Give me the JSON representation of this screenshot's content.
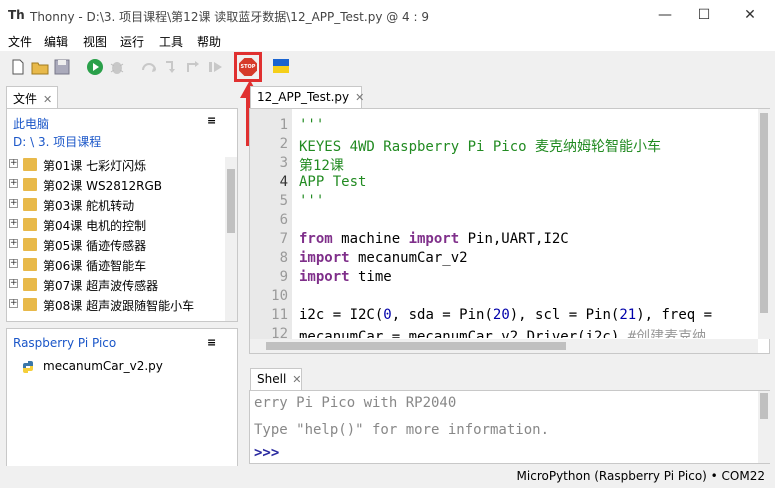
{
  "window": {
    "title": "Thonny  -  D:\\3. 项目课程\\第12课 读取蓝牙数据\\12_APP_Test.py  @  4 : 9",
    "app_icon": "Th",
    "minimize": "—",
    "maximize": "☐",
    "close": "✕"
  },
  "menu": [
    "文件",
    "编辑",
    "视图",
    "运行",
    "工具",
    "帮助"
  ],
  "toolbar": {
    "icons": [
      "new-file-icon",
      "open-file-icon",
      "save-icon",
      "run-icon",
      "debug-icon",
      "step-over-icon",
      "step-into-icon",
      "step-out-icon",
      "resume-icon",
      "stop-icon",
      "flag-icon"
    ],
    "stop_label": "STOP",
    "highlight_color": "#e03030"
  },
  "files_tab": {
    "label": "文件",
    "close": "✕"
  },
  "file_browser": {
    "section_title": "此电脑",
    "path": "D: \\ 3. 项目课程",
    "menu_glyph": "≡",
    "items": [
      "第01课 七彩灯闪烁",
      "第02课 WS2812RGB",
      "第03课 舵机转动",
      "第04课 电机的控制",
      "第05课 循迹传感器",
      "第06课 循迹智能车",
      "第07课 超声波传感器",
      "第08课 超声波跟随智能小车"
    ]
  },
  "device_panel": {
    "title": "Raspberry Pi Pico",
    "menu_glyph": "≡",
    "files": [
      "mecanumCar_v2.py"
    ]
  },
  "editor": {
    "tab_label": "12_APP_Test.py",
    "close": "✕",
    "line_numbers": [
      "1",
      "2",
      "3",
      "4",
      "5",
      "6",
      "7",
      "8",
      "9",
      "10",
      "11",
      "12"
    ],
    "lines": {
      "l1": "'''",
      "l2": "KEYES 4WD Raspberry Pi Pico 麦克纳姆轮智能小车",
      "l3": "第12课",
      "l4": "APP Test",
      "l5": "'''",
      "l7_kw1": "from",
      "l7_mid": " machine ",
      "l7_kw2": "import",
      "l7_rest": " Pin,UART,I2C",
      "l8_kw": "import",
      "l8_rest": " mecanumCar_v2",
      "l9_kw": "import",
      "l9_rest": " time",
      "l11_a": "i2c = I2C(",
      "l11_n1": "0",
      "l11_b": ", sda = Pin(",
      "l11_n2": "20",
      "l11_c": "), scl = Pin(",
      "l11_n3": "21",
      "l11_d": "), freq =",
      "l12_a": "mecanumCar = mecanumCar_v2.Driver(i2c)",
      "l12_cmt": " #创建麦克纳"
    }
  },
  "shell": {
    "tab_label": "Shell",
    "close": "✕",
    "line1": "erry Pi Pico with RP2040",
    "line2": "Type \"help()\" for more information.",
    "prompt": ">>>"
  },
  "status": {
    "interpreter": "MicroPython (Raspberry Pi Pico)  •  COM22"
  }
}
